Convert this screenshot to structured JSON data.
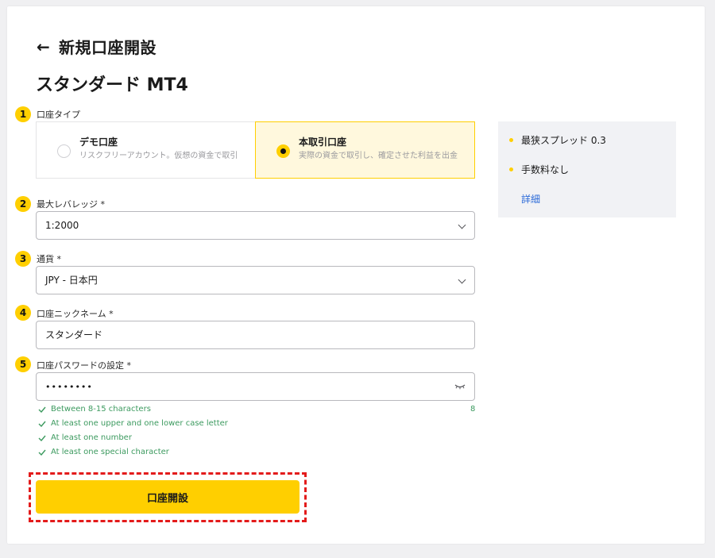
{
  "header": {
    "back_icon": "←",
    "title": "新規口座開設"
  },
  "account_title": "スタンダード MT4",
  "steps": [
    "1",
    "2",
    "3",
    "4",
    "5"
  ],
  "account_type": {
    "label": "口座タイプ",
    "options": [
      {
        "name": "デモ口座",
        "desc": "リスクフリーアカウント。仮想の資金で取引",
        "selected": false
      },
      {
        "name": "本取引口座",
        "desc": "実際の資金で取引し、確定させた利益を出金",
        "selected": true
      }
    ]
  },
  "leverage": {
    "label": "最大レバレッジ *",
    "value": "1:2000"
  },
  "currency": {
    "label": "通貨 *",
    "value": "JPY - 日本円"
  },
  "nickname": {
    "label": "口座ニックネーム *",
    "value": "スタンダード"
  },
  "password": {
    "label": "口座パスワードの設定 *",
    "value": "••••••••",
    "count": "8",
    "rules": [
      "Between 8-15 characters",
      "At least one upper and one lower case letter",
      "At least one number",
      "At least one special character"
    ]
  },
  "submit_label": "口座開設",
  "info": {
    "items": [
      "最狭スプレッド 0.3",
      "手数料なし"
    ],
    "link": "詳細"
  },
  "colors": {
    "accent": "#ffcf00",
    "success": "#3c9a5f",
    "highlight_border": "#e31b1b",
    "link": "#2b6ad8"
  }
}
